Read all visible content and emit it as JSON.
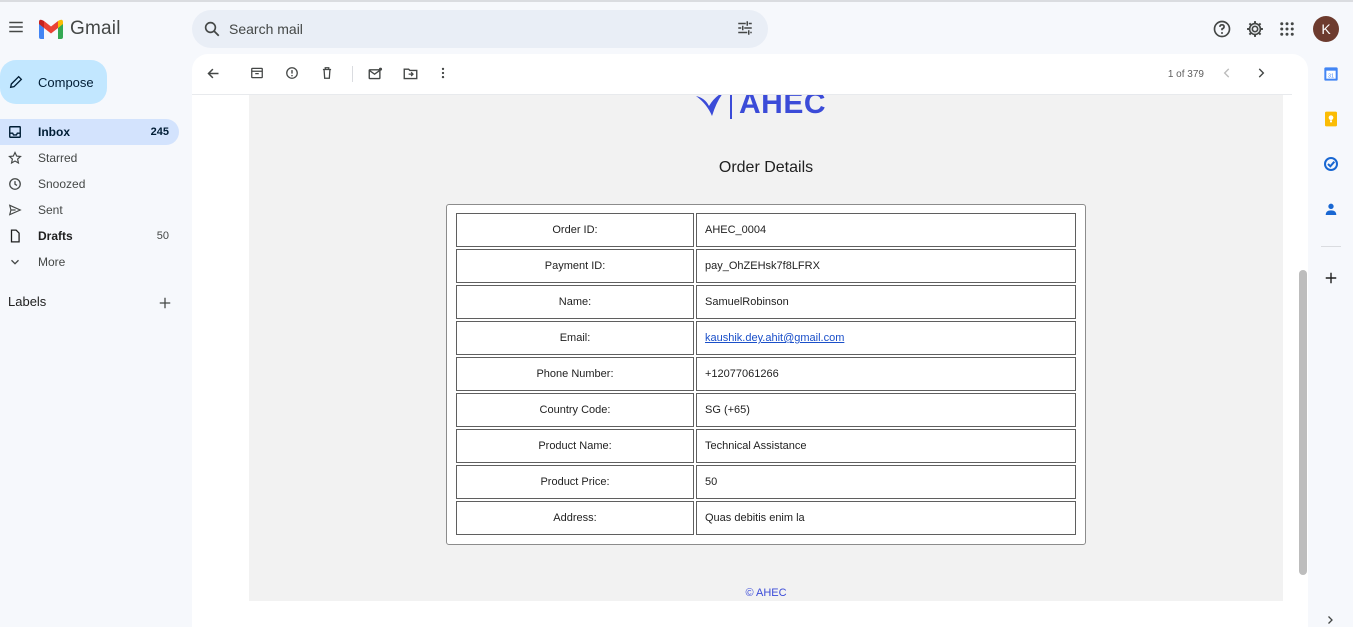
{
  "app": {
    "name": "Gmail",
    "avatar_letter": "K"
  },
  "search": {
    "placeholder": "Search mail"
  },
  "sidebar": {
    "compose_label": "Compose",
    "items": [
      {
        "label": "Inbox",
        "count": "245",
        "icon": "inbox-icon",
        "active": true
      },
      {
        "label": "Starred",
        "count": "",
        "icon": "star-icon"
      },
      {
        "label": "Snoozed",
        "count": "",
        "icon": "clock-icon"
      },
      {
        "label": "Sent",
        "count": "",
        "icon": "send-icon"
      },
      {
        "label": "Drafts",
        "count": "50",
        "icon": "draft-icon"
      },
      {
        "label": "More",
        "count": "",
        "icon": "chevron-down-icon"
      }
    ],
    "labels_heading": "Labels"
  },
  "toolbar": {
    "pager": "1 of 379"
  },
  "email": {
    "brand": "AHEC",
    "title": "Order Details",
    "rows": [
      {
        "key": "Order ID:",
        "value": "AHEC_0004"
      },
      {
        "key": "Payment ID:",
        "value": "pay_OhZEHsk7f8LFRX"
      },
      {
        "key": "Name:",
        "value": "SamuelRobinson"
      },
      {
        "key": "Email:",
        "value": "kaushik.dey.ahit@gmail.com"
      },
      {
        "key": "Phone Number:",
        "value": "+12077061266"
      },
      {
        "key": "Country Code:",
        "value": "SG (+65)"
      },
      {
        "key": "Product Name:",
        "value": "Technical Assistance"
      },
      {
        "key": "Product Price:",
        "value": "50"
      },
      {
        "key": "Address:",
        "value": "Quas debitis enim la"
      }
    ],
    "footer": "© AHEC"
  },
  "colors": {
    "accent": "#3b4bd8",
    "compose_bg": "#c2e7ff",
    "active_nav": "#d3e3fd",
    "avatar": "#6d3b2e"
  }
}
